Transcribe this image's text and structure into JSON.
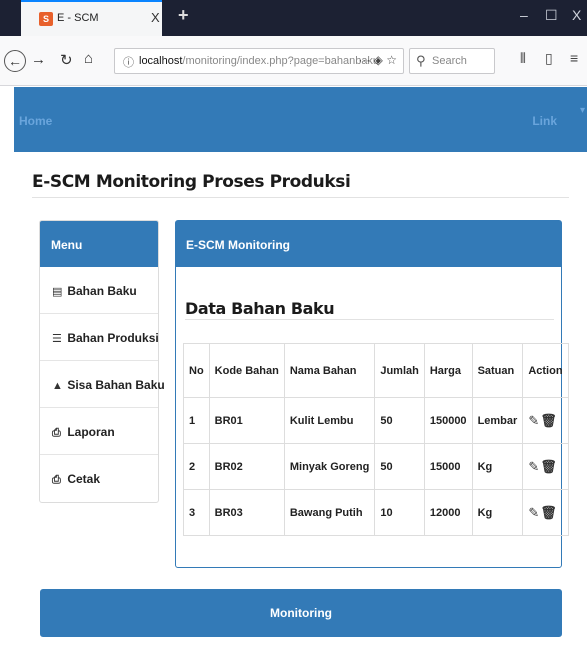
{
  "browser": {
    "tab_title": "E - SCM",
    "tab_close": "X",
    "new_tab": "+",
    "url_host": "localhost",
    "url_path": "/monitoring/index.php?page=bahanbaku",
    "search_placeholder": "Search",
    "window_controls": [
      "–",
      "☐",
      "X"
    ]
  },
  "topnav": {
    "home": "Home",
    "link": "Link",
    "caret": "▾"
  },
  "page_title": "E-SCM Monitoring Proses Produksi",
  "menu": {
    "heading": "Menu",
    "items": [
      {
        "icon": "book-icon",
        "label": "Bahan Baku"
      },
      {
        "icon": "database-icon",
        "label": "Bahan Produksi"
      },
      {
        "icon": "flask-icon",
        "label": "Sisa Bahan Baku"
      },
      {
        "icon": "print-icon",
        "label": "Laporan"
      },
      {
        "icon": "print-icon",
        "label": "Cetak"
      }
    ]
  },
  "panel": {
    "heading": "E-SCM Monitoring",
    "section_title": "Data Bahan Baku"
  },
  "table": {
    "columns": [
      "No",
      "Kode Bahan",
      "Nama Bahan",
      "Jumlah",
      "Harga",
      "Satuan",
      "Action"
    ],
    "rows": [
      [
        "1",
        "BR01",
        "Kulit Lembu",
        "50",
        "150000",
        "Lembar"
      ],
      [
        "2",
        "BR02",
        "Minyak Goreng",
        "50",
        "15000",
        "Kg"
      ],
      [
        "3",
        "BR03",
        "Bawang Putih",
        "10",
        "12000",
        "Kg"
      ]
    ]
  },
  "footer_button": "Monitoring",
  "colors": {
    "primary": "#337ab7",
    "tabbar": "#1c2133",
    "accent": "#0a84ff"
  }
}
